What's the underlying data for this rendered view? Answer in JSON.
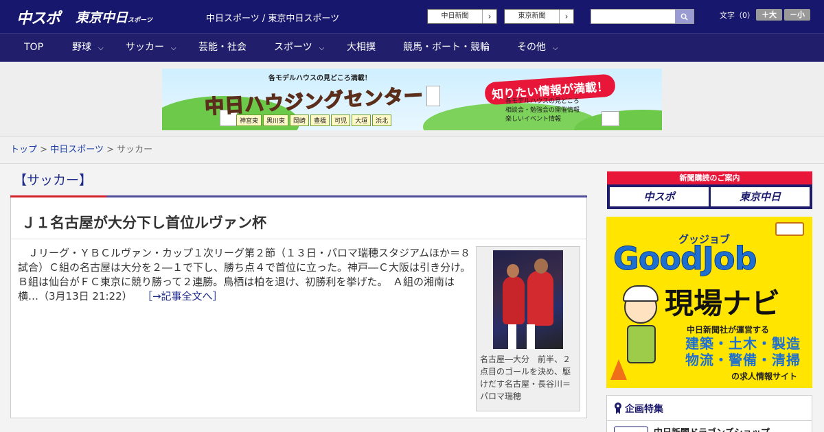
{
  "header": {
    "logo_chusupo": "中スポ",
    "logo_tokyo": "東京中日",
    "logo_tokyo_small": "スポーツ",
    "site_title": "中日スポーツ / 東京中日スポーツ",
    "link_chunichi": "中日新聞",
    "link_tokyo": "東京新聞",
    "search_placeholder": "",
    "fontsize_label": "文字（0）",
    "font_plus": "＋大",
    "font_minus": "－小"
  },
  "nav": {
    "items": [
      {
        "label": "TOP",
        "has_dropdown": false
      },
      {
        "label": "野球",
        "has_dropdown": true
      },
      {
        "label": "サッカー",
        "has_dropdown": true
      },
      {
        "label": "芸能・社会",
        "has_dropdown": false
      },
      {
        "label": "スポーツ",
        "has_dropdown": true
      },
      {
        "label": "大相撲",
        "has_dropdown": false
      },
      {
        "label": "競馬・ボート・競輪",
        "has_dropdown": false
      },
      {
        "label": "その他",
        "has_dropdown": true
      }
    ]
  },
  "ad_banner": {
    "top_text": "各モデルハウスの見どころ満載！",
    "main_text": "中日ハウジングセンター",
    "badge": "知りたい情報が満載！",
    "list": [
      "各モデルハウスの見どころ",
      "相談会・勉強会の開催情報",
      "楽しいイベント情報"
    ],
    "cities": [
      "神宮東",
      "黒川東",
      "岡崎",
      "豊橋",
      "可児",
      "大垣",
      "浜北"
    ]
  },
  "breadcrumb": {
    "home": "トップ",
    "section": "中日スポーツ",
    "current": "サッカー",
    "separator": ">"
  },
  "article": {
    "category": "【サッカー】",
    "title": "Ｊ１名古屋が大分下し首位ルヴァン杯",
    "body": "　Ｊリーグ・ＹＢＣルヴァン・カップ１次リーグ第２節（１３日・パロマ瑞穂スタジアムほか＝８試合）Ｃ組の名古屋は大分を２―１で下し、勝ち点４で首位に立った。神戸―Ｃ大阪は引き分け。Ｂ組は仙台がＦＣ東京に競り勝って２連勝。鳥栖は柏を退け、初勝利を挙げた。　Ａ組の湘南は横…",
    "timestamp": "（3月13日 21:22）",
    "more_link": "［→記事全文へ］",
    "photo_caption": "名古屋―大分　前半、２点目のゴールを決め、駆けだす名古屋・長谷川＝パロマ瑞穂"
  },
  "sidebar": {
    "subscribe_title": "新聞購読のご案内",
    "subscribe_chusupo": "中スポ",
    "subscribe_tokyo": "東京中日",
    "goodjob": {
      "small": "グッジョブ",
      "big": "GoodJob",
      "navi": "現場ナビ",
      "desc": "中日新聞社が運営する",
      "cats_line1": "建築・土木・製造",
      "cats_line2": "物流・警備・清掃",
      "site": "の求人情報サイト"
    },
    "special_title": "企画特集",
    "special_item": "中日新聞ドラゴンズショップ"
  },
  "colors": {
    "header_bg": "#18176e",
    "nav_bg": "#211f6c",
    "accent_red": "#d2202b",
    "link_blue": "#1a3ea8",
    "goodjob_yellow": "#ffe500"
  }
}
